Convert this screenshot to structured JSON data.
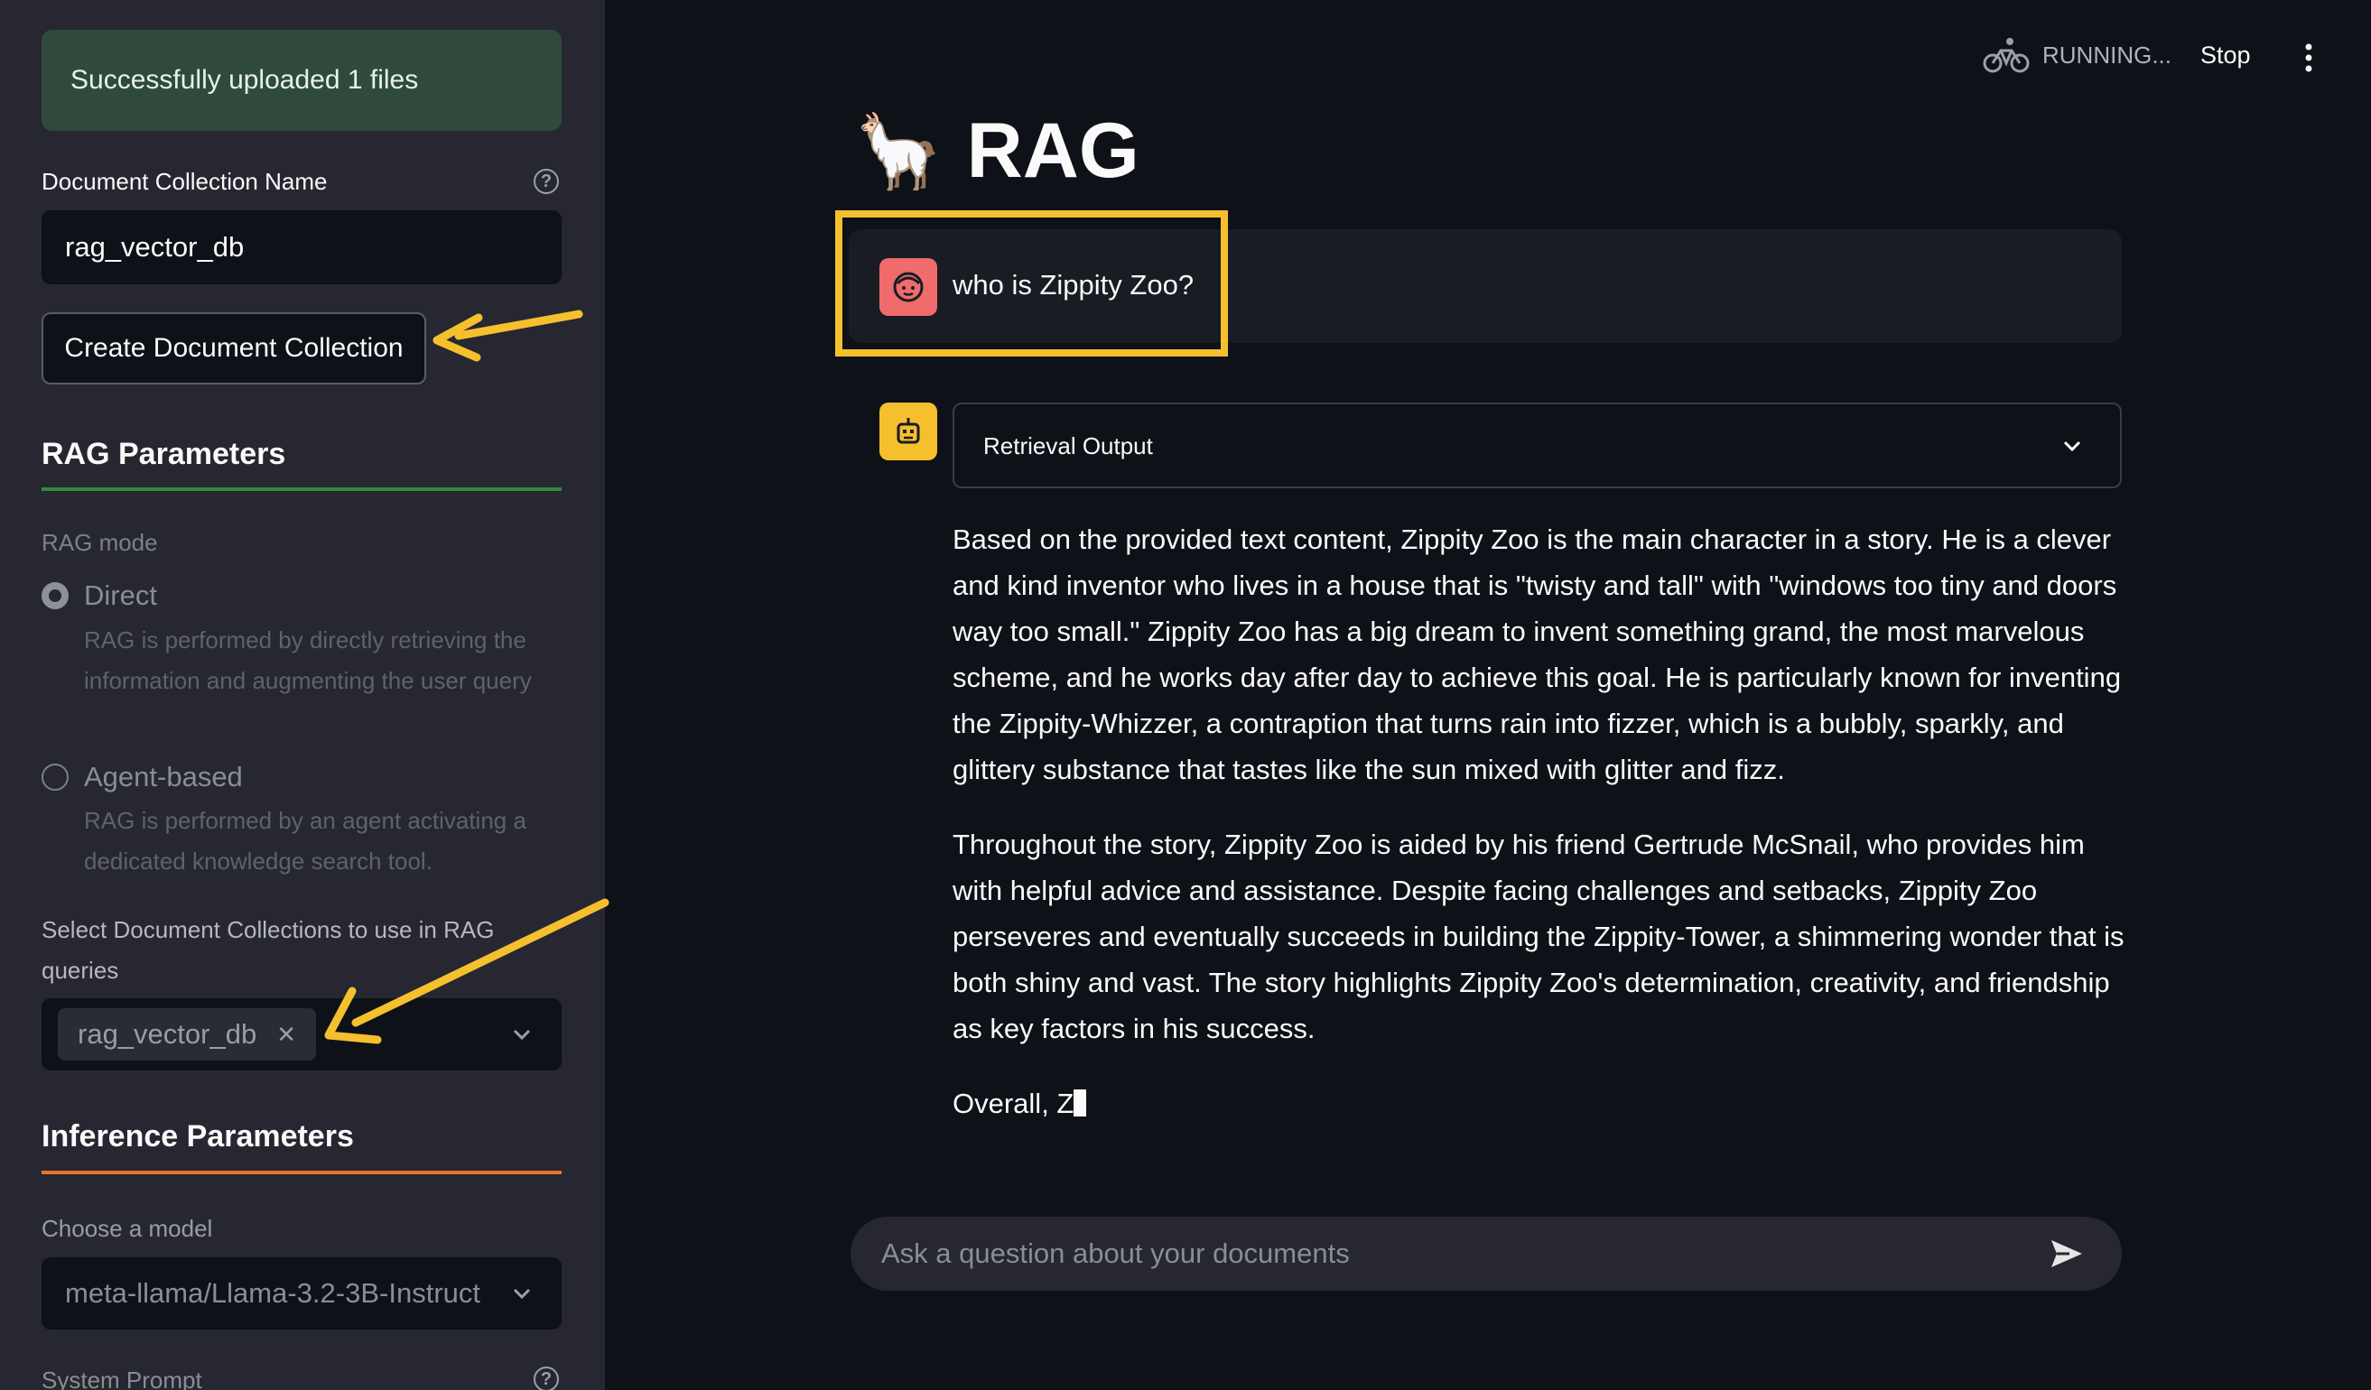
{
  "sidebar": {
    "upload_status": "Successfully uploaded 1 files",
    "collection_name_label": "Document Collection Name",
    "collection_name_value": "rag_vector_db",
    "create_button": "Create Document Collection",
    "rag_params_title": "RAG Parameters",
    "rag_mode_label": "RAG mode",
    "rag_modes": [
      {
        "label": "Direct",
        "desc": "RAG is performed by directly retrieving the information and augmenting the user query",
        "selected": true
      },
      {
        "label": "Agent-based",
        "desc": "RAG is performed by an agent activating a dedicated knowledge search tool.",
        "selected": false
      }
    ],
    "collections_label": "Select Document Collections to use in RAG queries",
    "selected_collection": "rag_vector_db",
    "inference_title": "Inference Parameters",
    "model_label": "Choose a model",
    "model_value": "meta-llama/Llama-3.2-3B-Instruct",
    "system_prompt_label": "System Prompt"
  },
  "header": {
    "status": "RUNNING...",
    "stop_label": "Stop"
  },
  "main": {
    "title_emoji": "🦙",
    "title": "RAG",
    "user_message": "who is Zippity Zoo?",
    "expander_label": "Retrieval Output",
    "answer_paragraphs": [
      "Based on the provided text content, Zippity Zoo is the main character in a story. He is a clever and kind inventor who lives in a house that is \"twisty and tall\" with \"windows too tiny and doors way too small.\" Zippity Zoo has a big dream to invent something grand, the most marvelous scheme, and he works day after day to achieve this goal. He is particularly known for inventing the Zippity-Whizzer, a contraption that turns rain into fizzer, which is a bubbly, sparkly, and glittery substance that tastes like the sun mixed with glitter and fizz.",
      "Throughout the story, Zippity Zoo is aided by his friend Gertrude McSnail, who provides him with helpful advice and assistance. Despite facing challenges and setbacks, Zippity Zoo perseveres and eventually succeeds in building the Zippity-Tower, a shimmering wonder that is both shiny and vast. The story highlights Zippity Zoo's determination, creativity, and friendship as key factors in his success.",
      "Overall, Z"
    ],
    "chat_placeholder": "Ask a question about your documents"
  },
  "colors": {
    "accent_highlight": "#f5bf2e",
    "rag_divider": "#2e8b3e",
    "inference_divider": "#e8742a",
    "user_avatar": "#f06b6b",
    "bot_avatar": "#f5bf2e"
  }
}
